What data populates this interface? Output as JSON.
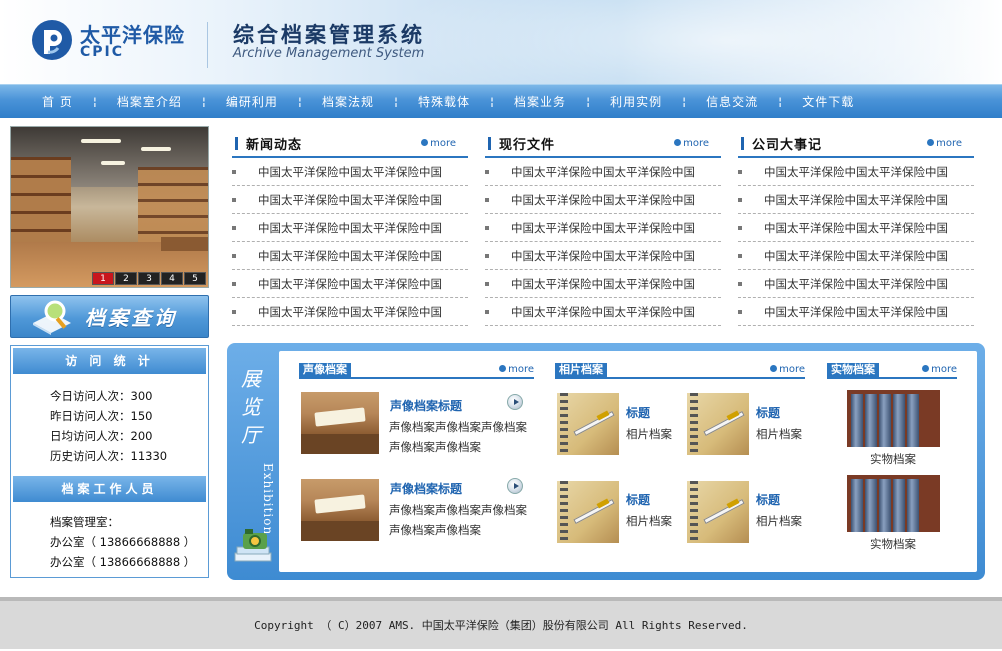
{
  "header": {
    "logo_cn": "太平洋保险",
    "logo_en": "CPIC",
    "system_title": "综合档案管理系统",
    "system_subtitle": "Archive Management System"
  },
  "nav": {
    "items": [
      "首 页",
      "档案室介绍",
      "编研利用",
      "档案法规",
      "特殊载体",
      "档案业务",
      "利用实例",
      "信息交流",
      "文件下载"
    ]
  },
  "slideshow": {
    "numbers": [
      "1",
      "2",
      "3",
      "4",
      "5"
    ],
    "active": "1"
  },
  "search_banner": {
    "label": "档案查询"
  },
  "stats": {
    "title": "访 问 统 计",
    "today": "今日访问人次：300",
    "yesterday": "昨日访问人次：150",
    "daily_avg": "日均访问人次：200",
    "history": "历史访问人次：11330"
  },
  "staff": {
    "title": "档案工作人员",
    "line1": "档案管理室：",
    "line2": "办公室（ 13866668888 ）",
    "line3": "办公室（ 13866668888 ）"
  },
  "more_label": "more",
  "news": [
    {
      "title": "新闻动态",
      "items": [
        "中国太平洋保险中国太平洋保险中国",
        "中国太平洋保险中国太平洋保险中国",
        "中国太平洋保险中国太平洋保险中国",
        "中国太平洋保险中国太平洋保险中国",
        "中国太平洋保险中国太平洋保险中国",
        "中国太平洋保险中国太平洋保险中国"
      ]
    },
    {
      "title": "现行文件",
      "items": [
        "中国太平洋保险中国太平洋保险中国",
        "中国太平洋保险中国太平洋保险中国",
        "中国太平洋保险中国太平洋保险中国",
        "中国太平洋保险中国太平洋保险中国",
        "中国太平洋保险中国太平洋保险中国",
        "中国太平洋保险中国太平洋保险中国"
      ]
    },
    {
      "title": "公司大事记",
      "items": [
        "中国太平洋保险中国太平洋保险中国",
        "中国太平洋保险中国太平洋保险中国",
        "中国太平洋保险中国太平洋保险中国",
        "中国太平洋保险中国太平洋保险中国",
        "中国太平洋保险中国太平洋保险中国",
        "中国太平洋保险中国太平洋保险中国"
      ]
    }
  ],
  "exhibition": {
    "title_zh": "展览厅",
    "title_en": "Exhibition",
    "audio": {
      "heading": "声像档案",
      "items": [
        {
          "title": "声像档案标题",
          "line1": "声像档案声像档案声像档案",
          "line2": "声像档案声像档案"
        },
        {
          "title": "声像档案标题",
          "line1": "声像档案声像档案声像档案",
          "line2": "声像档案声像档案"
        }
      ]
    },
    "photo": {
      "heading": "相片档案",
      "items": [
        {
          "title": "标题",
          "caption": "相片档案"
        },
        {
          "title": "标题",
          "caption": "相片档案"
        },
        {
          "title": "标题",
          "caption": "相片档案"
        },
        {
          "title": "标题",
          "caption": "相片档案"
        }
      ]
    },
    "physical": {
      "heading": "实物档案",
      "items": [
        "实物档案",
        "实物档案"
      ]
    }
  },
  "footer": {
    "copyright": "Copyright （ C）2007 AMS. 中国太平洋保险（集团）股份有限公司  All Rights Reserved."
  },
  "colors": {
    "brand_blue": "#1f5aa6",
    "nav_blue": "#3f8bd1",
    "accent_red": "#c8161d"
  }
}
